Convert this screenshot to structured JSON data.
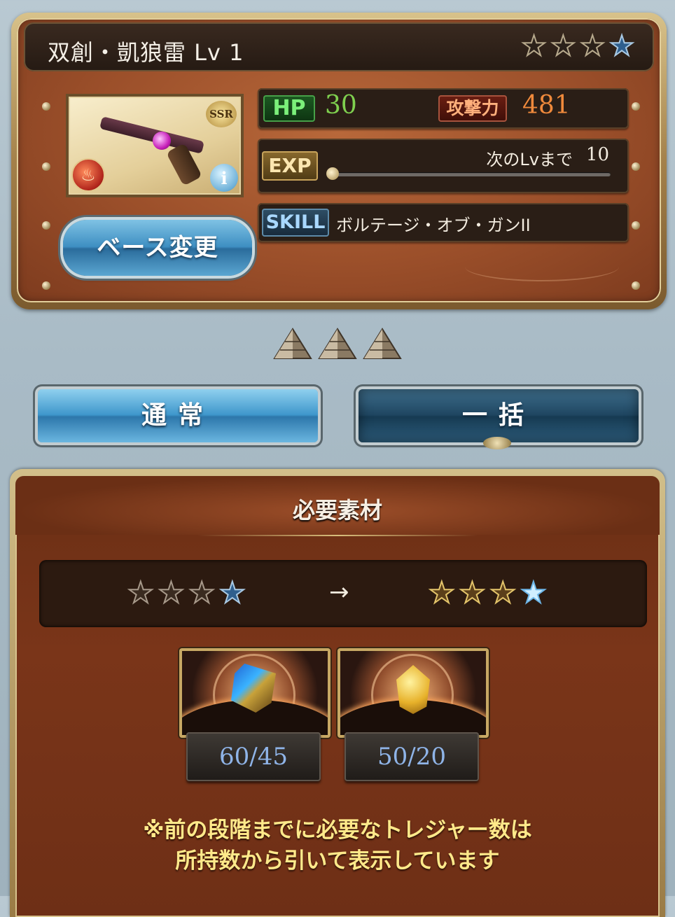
{
  "weapon": {
    "name": "双創・凱狼雷 Lv 1",
    "rarity_badge": "SSR",
    "element_icon": "fire-icon",
    "info_icon": "info-icon",
    "stars_total": 4,
    "stars_blue": 1
  },
  "stats": {
    "hp_label": "HP",
    "hp_value": "30",
    "atk_label": "攻撃力",
    "atk_value": "481",
    "exp_label": "EXP",
    "next_level_label": "次のLvまで",
    "next_level_value": "10",
    "exp_progress": 0,
    "skill_label": "SKILL",
    "skill_name": "ボルテージ・オブ・ガンII"
  },
  "base_change_button": "ベース変更",
  "uncap_indicators": 3,
  "mode_buttons": {
    "normal": "通常",
    "bulk": "一括"
  },
  "materials": {
    "title": "必要素材",
    "arrow": "→",
    "items": [
      {
        "icon": "blue-crystal-treasure-icon",
        "count": "60/45"
      },
      {
        "icon": "gold-gem-treasure-icon",
        "count": "50/20"
      }
    ],
    "note_line1": "※前の段階までに必要なトレジャー数は",
    "note_line2": "所持数から引いて表示しています"
  },
  "colors": {
    "hp_value": "#7fd04f",
    "atk_value": "#f08a3c",
    "note_text": "#ffe98a",
    "count_text": "#8fb4e8"
  }
}
